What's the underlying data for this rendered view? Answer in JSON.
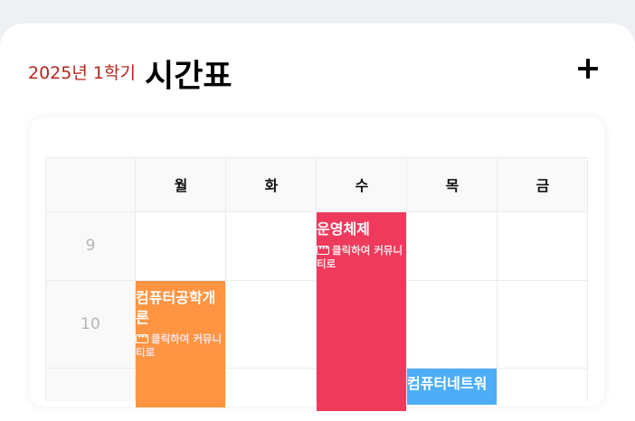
{
  "header": {
    "semester": "2025년 1학기",
    "title": "시간표",
    "add_label": "+"
  },
  "days": [
    "월",
    "화",
    "수",
    "목",
    "금"
  ],
  "times": [
    "9",
    "10",
    ""
  ],
  "courses": [
    {
      "name": "운영체제",
      "day": "수",
      "start": 9,
      "link": "클릭하여 커뮤니티로",
      "color": "#ee3a5c"
    },
    {
      "name": "컴퓨터공학개론",
      "day": "월",
      "start": 10,
      "link": "클릭하여 커뮤니티로",
      "color": "#ff9542"
    },
    {
      "name": "컴퓨터네트워",
      "day": "목",
      "start": 11,
      "link": "",
      "color": "#4dadf7"
    }
  ]
}
